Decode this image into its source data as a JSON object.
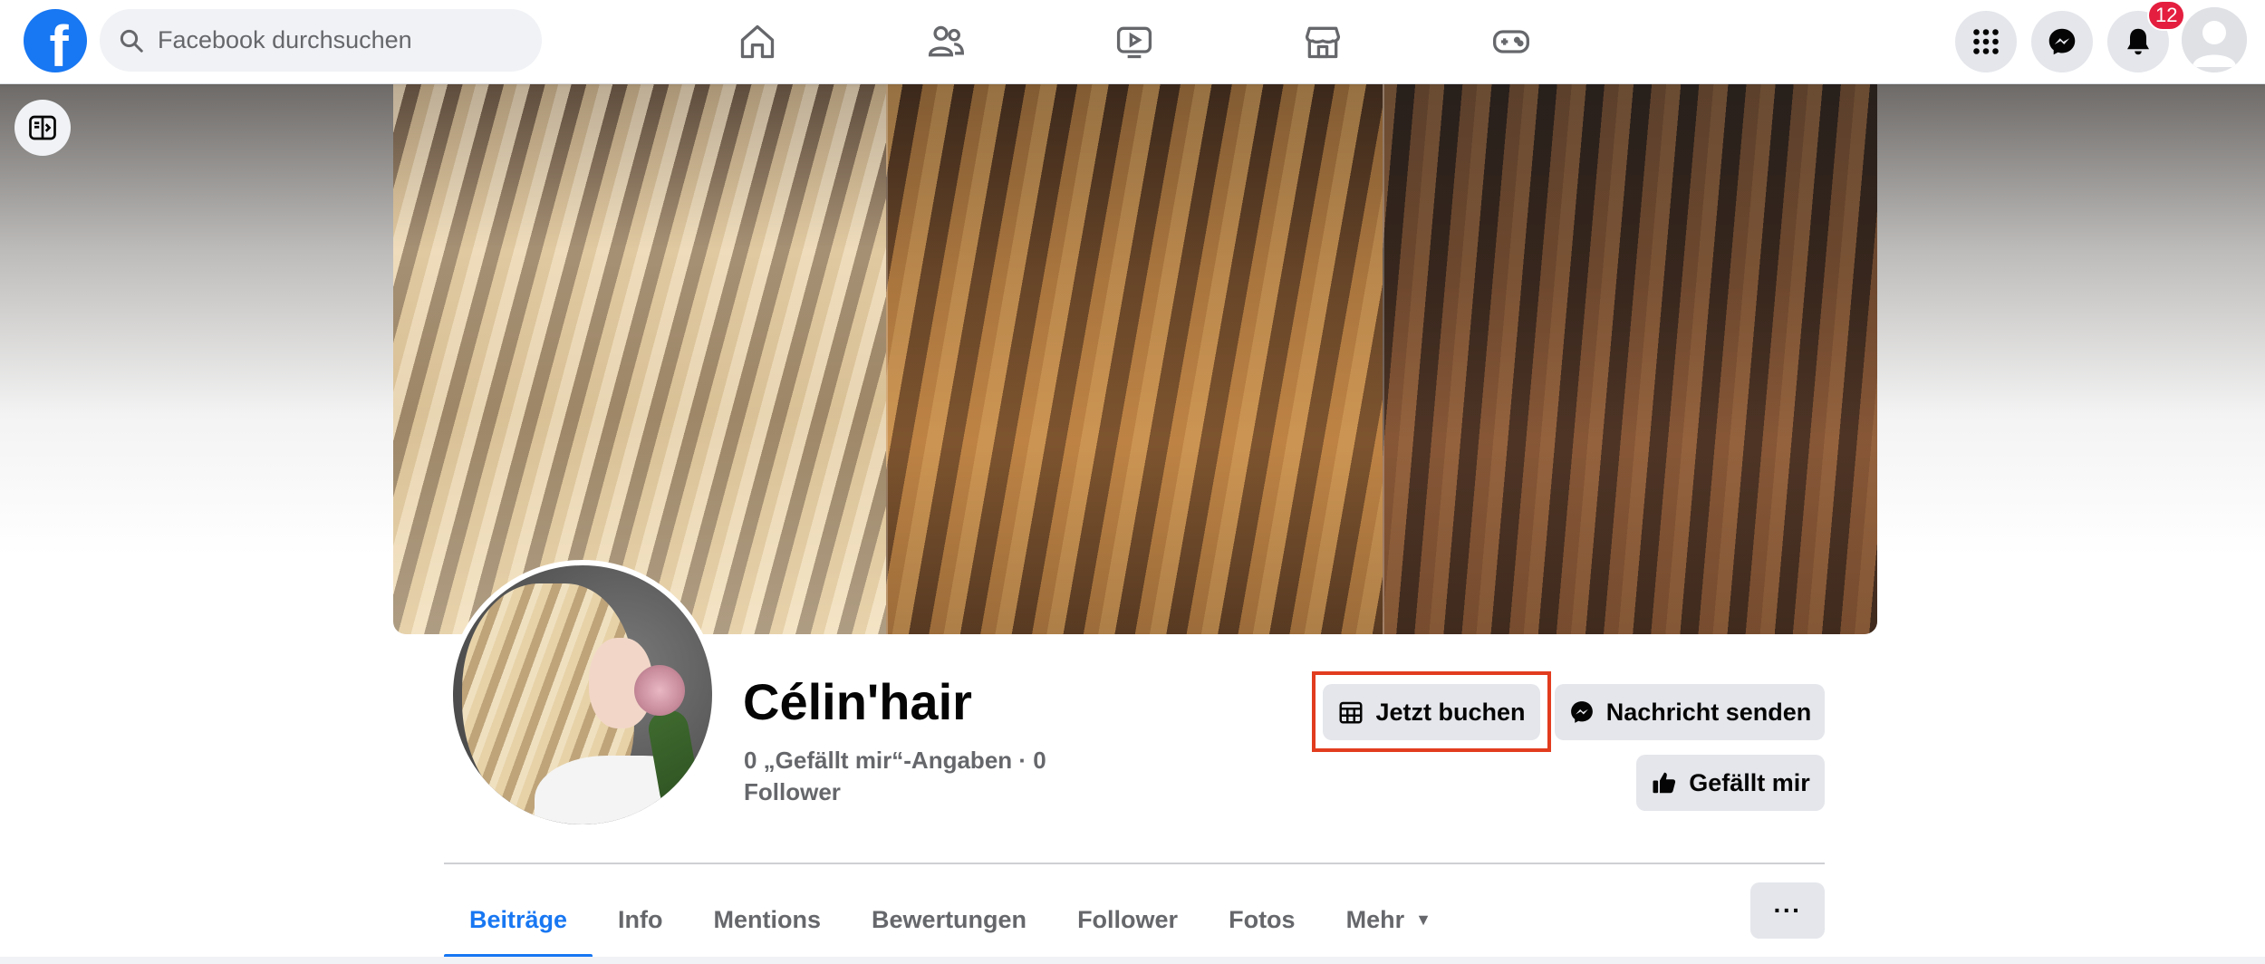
{
  "header": {
    "logo_letter": "f",
    "search_placeholder": "Facebook durchsuchen",
    "nav_icons": [
      "home-icon",
      "friends-icon",
      "watch-icon",
      "marketplace-icon",
      "gaming-icon"
    ],
    "right_icons": [
      "menu-grid-icon",
      "messenger-icon",
      "notifications-icon"
    ],
    "notification_count": "12"
  },
  "cover": {
    "panels": [
      "blonde-balayage-photo",
      "caramel-balayage-photo",
      "brunette-balayage-photo"
    ]
  },
  "profile": {
    "name": "Célin'hair",
    "stats_line1": "0 „Gefällt mir“-Angaben · 0",
    "stats_line2": "Follower"
  },
  "actions": {
    "book_label": "Jetzt buchen",
    "message_label": "Nachricht senden",
    "like_label": "Gefällt mir"
  },
  "tabs": [
    {
      "label": "Beiträge",
      "active": true
    },
    {
      "label": "Info"
    },
    {
      "label": "Mentions"
    },
    {
      "label": "Bewertungen"
    },
    {
      "label": "Follower"
    },
    {
      "label": "Fotos"
    },
    {
      "label": "Mehr",
      "dropdown": true
    }
  ],
  "more_button": "···",
  "colors": {
    "brand": "#1877f2",
    "badge": "#e41e3f",
    "highlight": "#e23c1f",
    "button_bg": "#e4e6eb"
  }
}
